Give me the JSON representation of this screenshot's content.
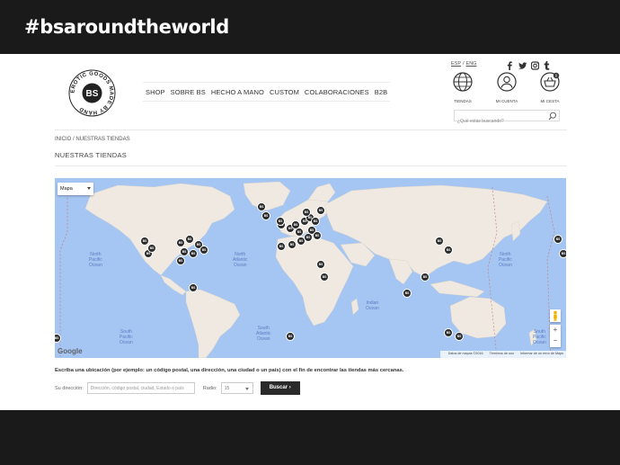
{
  "banner": {
    "title": "#bsaroundtheworld"
  },
  "header": {
    "logo_text": "BS",
    "logo_ring_text": "EROTIC GOODS MADE BY HAND",
    "nav": [
      "SHOP",
      "SOBRE BS",
      "HECHO A MANO",
      "CUSTOM",
      "COLABORACIONES",
      "B2B"
    ],
    "lang": {
      "esp": "ESP",
      "separator": "/",
      "eng": "ENG"
    },
    "social_icons": [
      "facebook-icon",
      "twitter-icon",
      "instagram-icon",
      "tumblr-icon"
    ],
    "icons": [
      {
        "name": "globe-icon",
        "label": "TIENDAS"
      },
      {
        "name": "user-icon",
        "label": "MI CUENTA"
      },
      {
        "name": "basket-icon",
        "label": "MI CESTA",
        "badge": "0"
      }
    ],
    "search_placeholder": "¿Qué estás buscando?"
  },
  "breadcrumb": {
    "home": "INICIO",
    "separator": "/",
    "current": "NUESTRAS TIENDAS"
  },
  "page_title": "NUESTRAS TIENDAS",
  "map": {
    "type_select": "Mapa",
    "pin_label": "BS",
    "oceans": [
      {
        "name": "North Pacific Ocean",
        "l1": "North",
        "l2": "Pacific",
        "l3": "Ocean"
      },
      {
        "name": "North Atlantic Ocean",
        "l1": "North",
        "l2": "Atlantic",
        "l3": "Ocean"
      },
      {
        "name": "North Pacific Ocean right",
        "l1": "North",
        "l2": "Pacific",
        "l3": "Ocean"
      },
      {
        "name": "South Pacific Ocean",
        "l1": "South",
        "l2": "Pacific",
        "l3": "Ocean"
      },
      {
        "name": "South Atlantic Ocean",
        "l1": "South",
        "l2": "Atlantic",
        "l3": "Ocean"
      },
      {
        "name": "Indian Ocean",
        "l1": "Indian",
        "l2": "Ocean",
        "l3": ""
      },
      {
        "name": "South Pacific Ocean right",
        "l1": "South",
        "l2": "Pacific",
        "l3": "Ocean"
      }
    ],
    "zoom_in": "+",
    "zoom_out": "−",
    "google": "Google",
    "attribution": {
      "data": "Datos de mapas ©2016",
      "terms": "Términos de uso",
      "report": "Informar de un error de Maps"
    }
  },
  "store_search": {
    "hint": "Escriba una ubicación (por ejemplo: un código postal, una dirección, una ciudad o un país) con el fin de encontrar las tiendas más cercanas.",
    "address_label": "Su dirección:",
    "address_placeholder": "Dirección, código postal, ciudad, Estado o país",
    "radius_label": "Radio:",
    "radius_value": "15",
    "search_button": "Buscar ›"
  }
}
